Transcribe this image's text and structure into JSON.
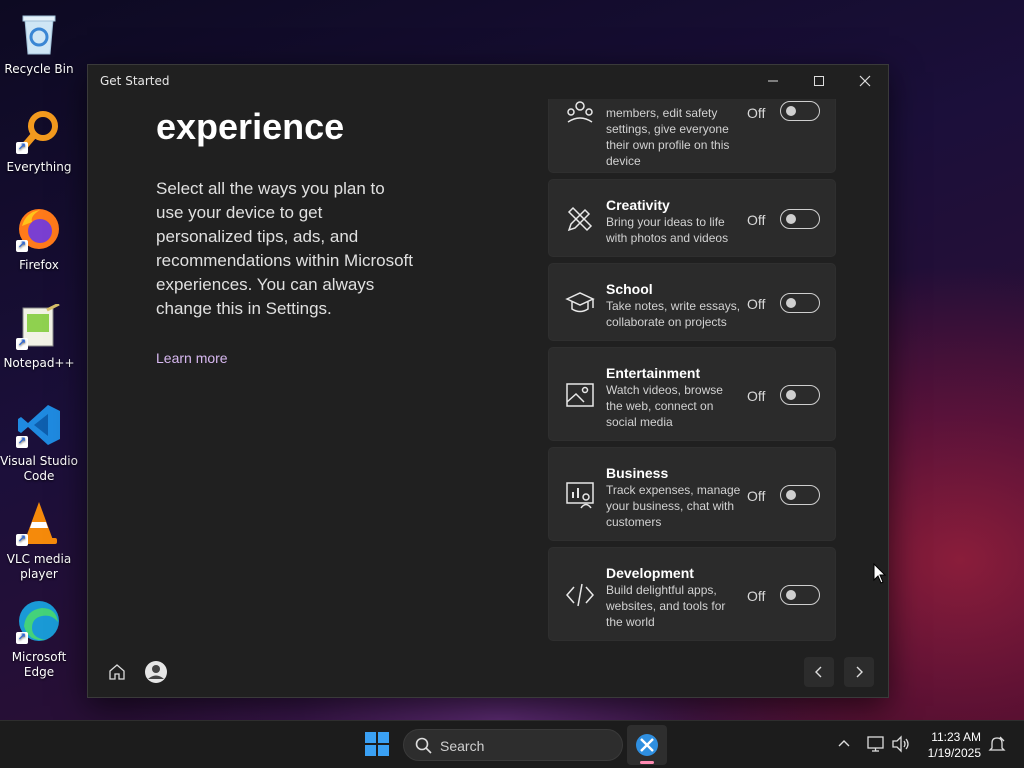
{
  "desktop": {
    "icons": [
      {
        "label": "Recycle Bin"
      },
      {
        "label": "Everything"
      },
      {
        "label": "Firefox"
      },
      {
        "label": "Notepad++"
      },
      {
        "label": "Visual Studio Code"
      },
      {
        "label": "VLC media player"
      },
      {
        "label": "Microsoft Edge"
      }
    ]
  },
  "window": {
    "title": "Get Started",
    "heading": "experience",
    "description": "Select all the ways you plan to use your device to get personalized tips, ads, and recommendations within Microsoft experiences. You can always change this in Settings.",
    "learn_more": "Learn more",
    "cards": [
      {
        "title": "",
        "subtitle": "members, edit safety settings, give everyone their own profile on this device",
        "state": "Off",
        "icon": "family-icon"
      },
      {
        "title": "Creativity",
        "subtitle": "Bring your ideas to life with photos and videos",
        "state": "Off",
        "icon": "pencil-ruler-icon"
      },
      {
        "title": "School",
        "subtitle": "Take notes, write essays, collaborate on projects",
        "state": "Off",
        "icon": "graduation-cap-icon"
      },
      {
        "title": "Entertainment",
        "subtitle": "Watch videos, browse the web, connect on social media",
        "state": "Off",
        "icon": "picture-icon"
      },
      {
        "title": "Business",
        "subtitle": "Track expenses, manage your business, chat with customers",
        "state": "Off",
        "icon": "business-chart-icon"
      },
      {
        "title": "Development",
        "subtitle": "Build delightful apps, websites, and tools for the world",
        "state": "Off",
        "icon": "code-icon"
      }
    ]
  },
  "taskbar": {
    "search_label": "Search",
    "time": "11:23 AM",
    "date": "1/19/2025"
  },
  "colors": {
    "window_bg": "#202020",
    "card_bg": "#2b2b2b",
    "link": "#d7b8f0",
    "taskbar_bg": "#1c1c1c"
  }
}
